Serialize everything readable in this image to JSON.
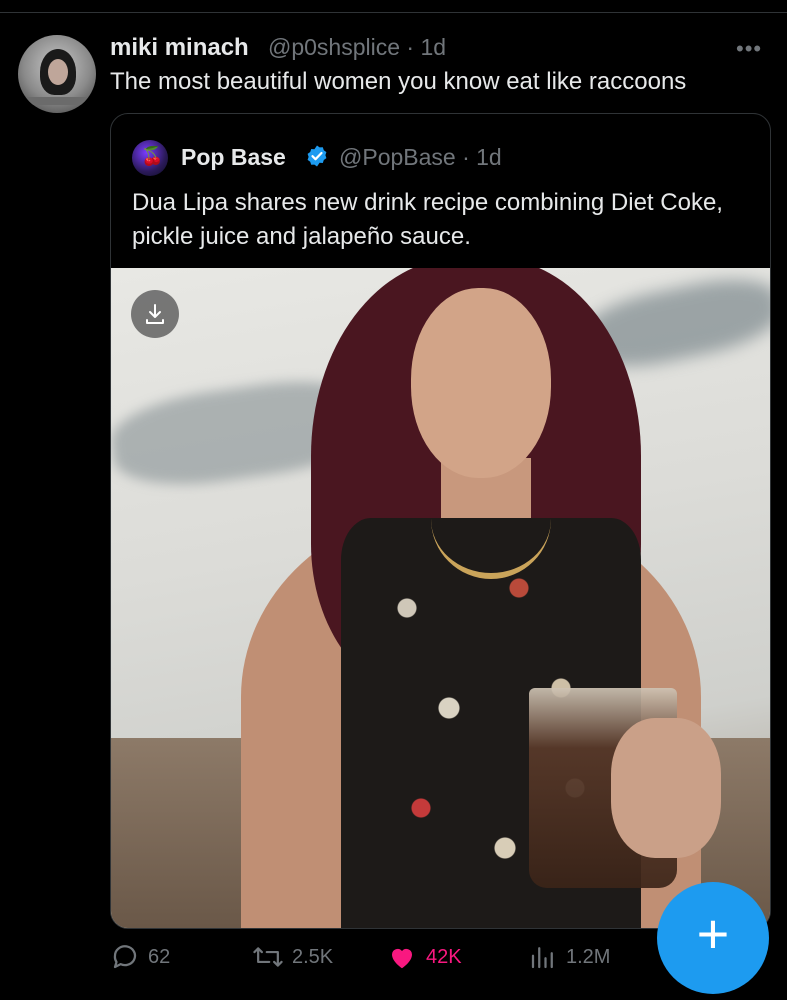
{
  "tweet": {
    "author_name": "miki minach",
    "author_meta": "@p0shsplice · 1d",
    "text": "The most beautiful women you know eat like raccoons",
    "more_label": "•••"
  },
  "quote": {
    "author_name": "Pop Base",
    "author_meta": "@PopBase · 1d",
    "text": "Dua Lipa shares new drink recipe combining Diet Coke, pickle juice and jalapeño sauce."
  },
  "actions": {
    "replies": "62",
    "retweets": "2.5K",
    "likes": "42K",
    "views": "1.2M"
  },
  "fab": {
    "label": "+"
  },
  "colors": {
    "accent": "#1d9bf0",
    "like": "#f91880",
    "muted": "#71767b",
    "text": "#e7e9ea",
    "background": "#000000"
  }
}
